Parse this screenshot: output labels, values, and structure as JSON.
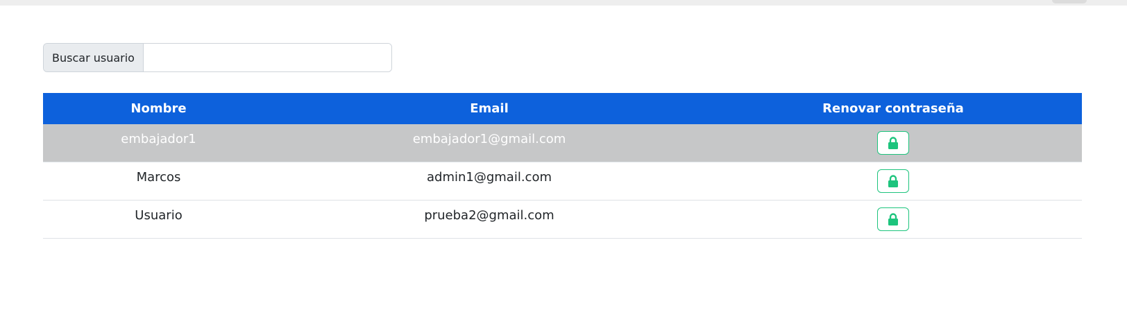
{
  "search": {
    "label": "Buscar usuario",
    "value": "",
    "placeholder": ""
  },
  "table": {
    "headers": {
      "name": "Nombre",
      "email": "Email",
      "renew": "Renovar contraseña"
    },
    "rows": [
      {
        "name": "embajador1",
        "email": "embajador1@gmail.com",
        "selected": true
      },
      {
        "name": "Marcos",
        "email": "admin1@gmail.com",
        "selected": false
      },
      {
        "name": "Usuario",
        "email": "prueba2@gmail.com",
        "selected": false
      }
    ],
    "action_icon": "lock-icon"
  },
  "colors": {
    "header_bg": "#0d61dc",
    "selected_row_bg": "#c6c7c8",
    "action_accent": "#1dc47d"
  }
}
